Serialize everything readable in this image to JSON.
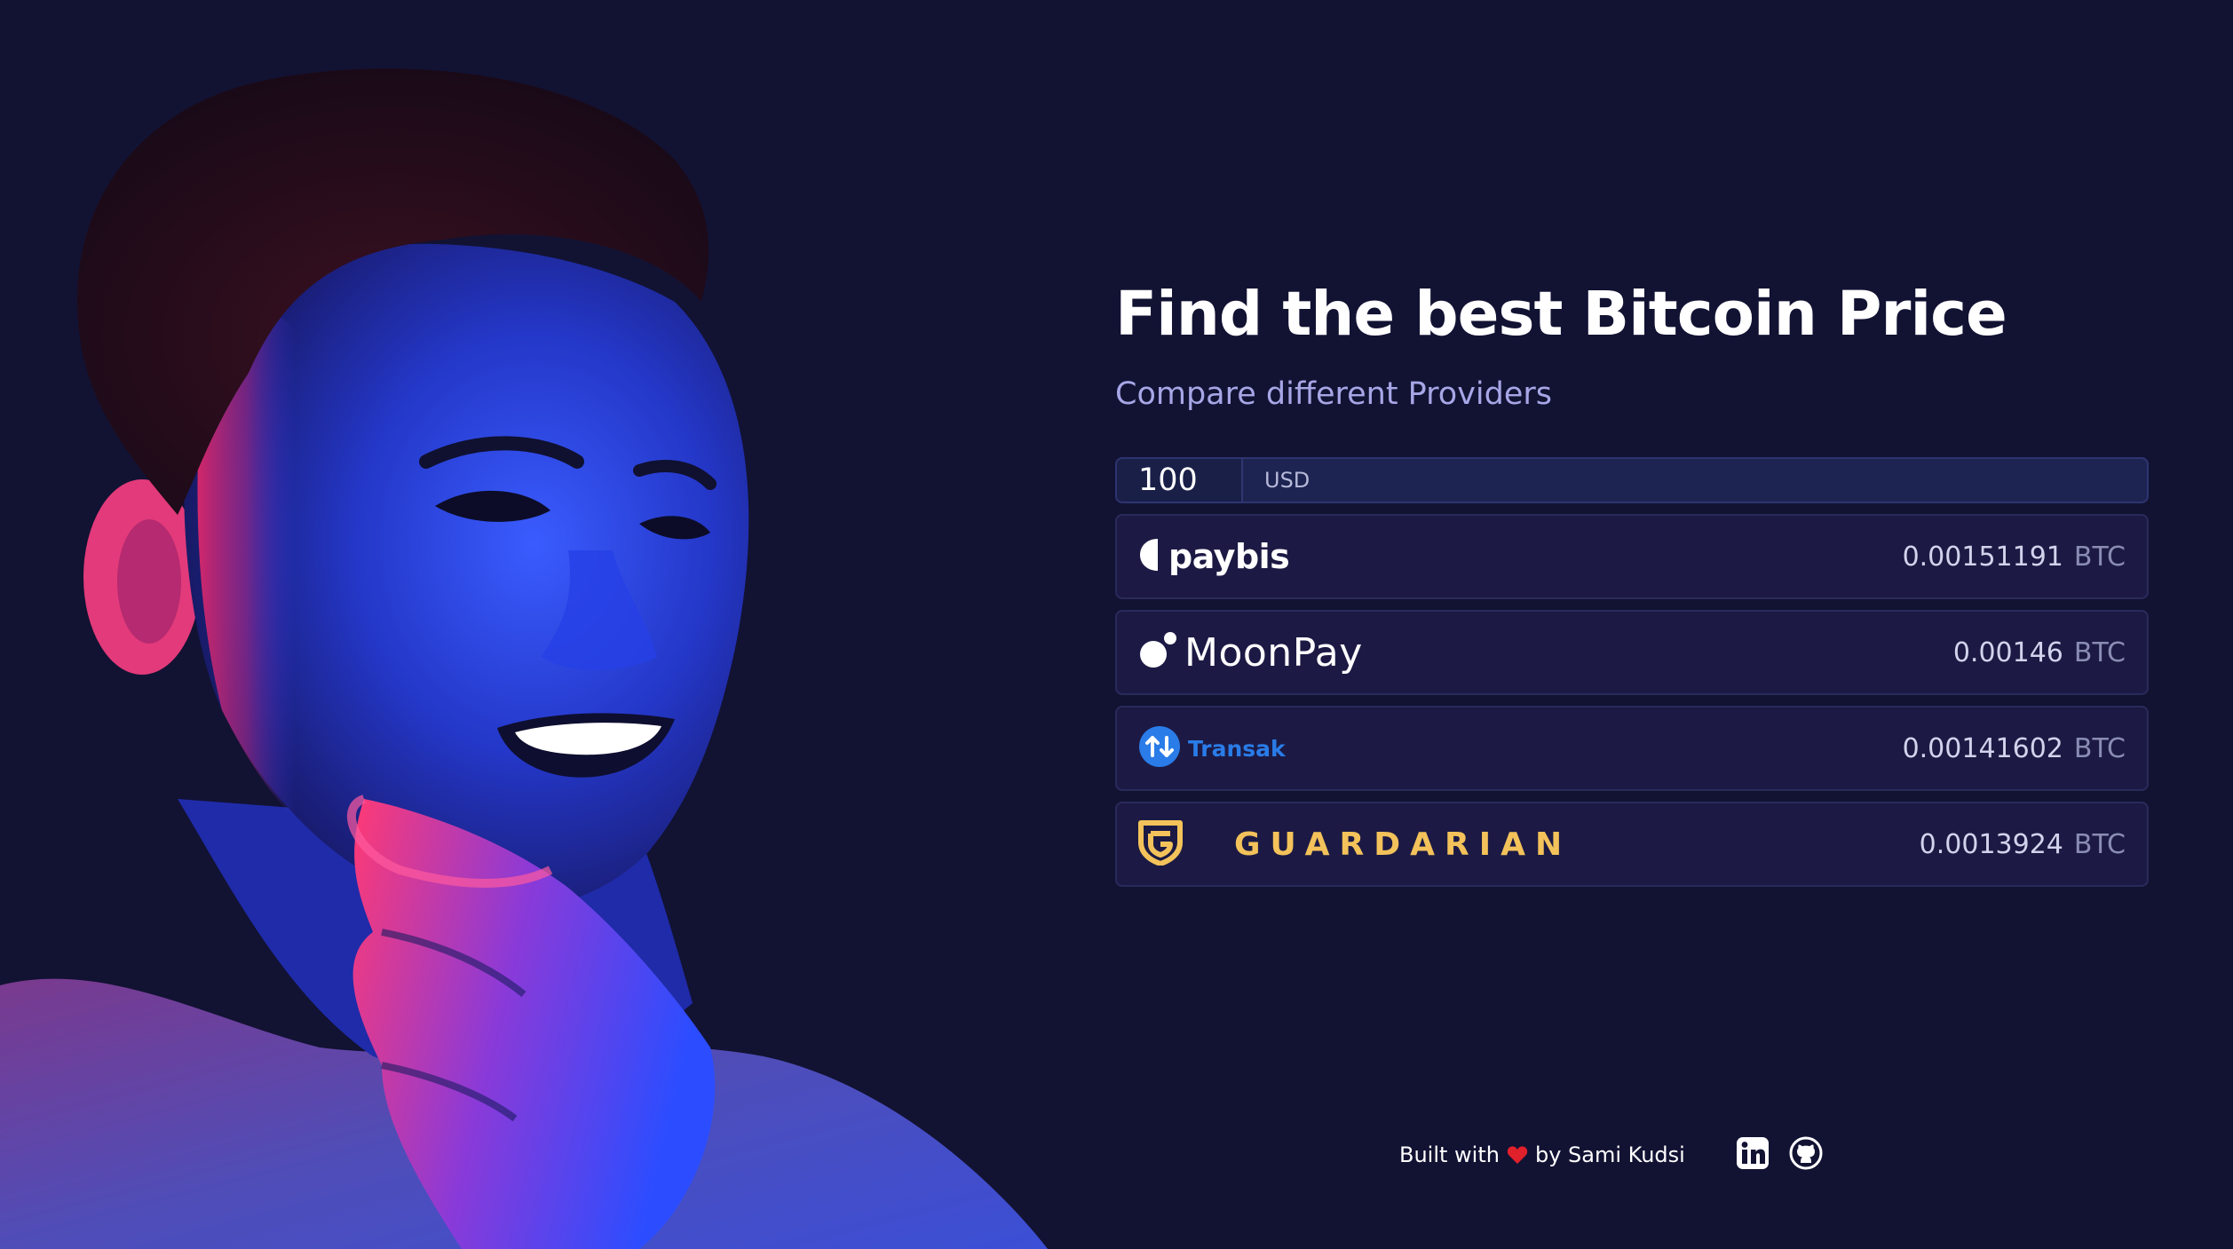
{
  "hero": {
    "image_description_icon": "portrait-photo"
  },
  "header": {
    "title": "Find the best Bitcoin Price",
    "subtitle": "Compare different Providers"
  },
  "amount": {
    "value": "100",
    "currency": "USD"
  },
  "providers": [
    {
      "name": "paybis",
      "logo_icon": "paybis-half-moon-icon",
      "price": "0.00151191",
      "unit": "BTC"
    },
    {
      "name": "MoonPay",
      "logo_icon": "moonpay-dots-icon",
      "price": "0.00146",
      "unit": "BTC"
    },
    {
      "name": "Transak",
      "logo_icon": "transak-arrows-icon",
      "price": "0.00141602",
      "unit": "BTC"
    },
    {
      "name": "GUARDARIAN",
      "logo_icon": "guardarian-shield-icon",
      "price": "0.0013924",
      "unit": "BTC"
    }
  ],
  "footer": {
    "built_with": "Built with",
    "by": "by Sami Kudsi",
    "heart_icon": "heart-icon",
    "links": [
      {
        "icon": "linkedin-icon"
      },
      {
        "icon": "github-icon"
      }
    ]
  },
  "colors": {
    "background": "#121233",
    "row_background": "#1c1a44",
    "subtitle": "#a7a6e6",
    "guardarian_gold": "#f3c25a",
    "transak_blue": "#2a7ce8",
    "heart_red": "#e0202a"
  }
}
